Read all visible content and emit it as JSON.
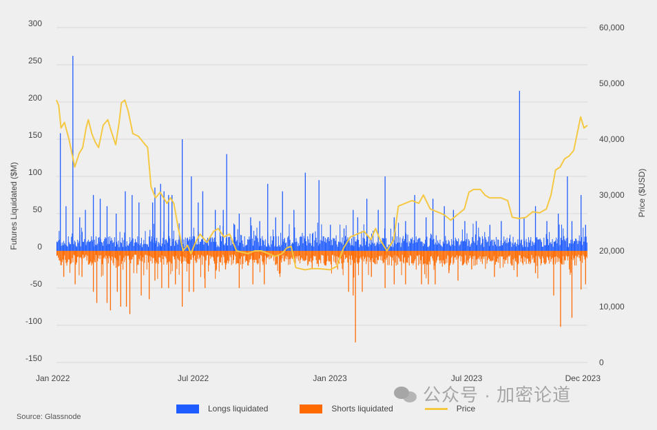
{
  "chart_data": {
    "type": "bar",
    "source": "Source: Glassnode",
    "ylabel_left": "Futures Liquidated ($M)",
    "ylabel_right": "Price ($USD)",
    "ylim_left": [
      -150,
      300
    ],
    "ylim_right": [
      0,
      60000
    ],
    "yticks_left": [
      "300",
      "250",
      "200",
      "150",
      "100",
      "50",
      "0",
      "-50",
      "-100",
      "-150"
    ],
    "yticks_left_values": [
      300,
      250,
      200,
      150,
      100,
      50,
      0,
      -50,
      -100,
      -150
    ],
    "yticks_right": [
      "60,000",
      "50,000",
      "40,000",
      "30,000",
      "20,000",
      "10,000",
      "0"
    ],
    "yticks_right_values": [
      60000,
      50000,
      40000,
      30000,
      20000,
      10000,
      0
    ],
    "xticks": [
      "Jan 2022",
      "Jul 2022",
      "Jan 2023",
      "Jul 2023",
      "Dec 2023"
    ],
    "xticks_months": [
      0,
      6,
      12,
      18,
      23
    ],
    "xlim_months": [
      0,
      23.3
    ],
    "grid": true,
    "colors": {
      "longs": "#1f5cff",
      "shorts": "#ff6a00",
      "price": "#f5c842",
      "grid": "#d9d9d9"
    },
    "series": [
      {
        "name": "Longs liquidated",
        "kind": "bar",
        "baseline_range": [
          5,
          20
        ],
        "spikes_month_value": [
          [
            0.15,
            158
          ],
          [
            0.4,
            60
          ],
          [
            0.7,
            262
          ],
          [
            1.0,
            45
          ],
          [
            1.25,
            55
          ],
          [
            1.6,
            75
          ],
          [
            1.9,
            70
          ],
          [
            2.2,
            60
          ],
          [
            2.6,
            50
          ],
          [
            3.0,
            80
          ],
          [
            3.3,
            75
          ],
          [
            3.6,
            65
          ],
          [
            4.2,
            65
          ],
          [
            4.3,
            85
          ],
          [
            4.55,
            90
          ],
          [
            4.7,
            80
          ],
          [
            4.9,
            75
          ],
          [
            5.05,
            75
          ],
          [
            5.5,
            150
          ],
          [
            5.9,
            100
          ],
          [
            6.2,
            65
          ],
          [
            6.4,
            80
          ],
          [
            6.95,
            55
          ],
          [
            7.3,
            55
          ],
          [
            7.45,
            130
          ],
          [
            7.8,
            35
          ],
          [
            8.0,
            50
          ],
          [
            8.5,
            45
          ],
          [
            8.9,
            40
          ],
          [
            9.25,
            90
          ],
          [
            9.6,
            45
          ],
          [
            9.9,
            80
          ],
          [
            10.4,
            55
          ],
          [
            10.9,
            105
          ],
          [
            11.5,
            95
          ],
          [
            12.0,
            35
          ],
          [
            12.6,
            30
          ],
          [
            13.0,
            55
          ],
          [
            13.2,
            45
          ],
          [
            13.6,
            70
          ],
          [
            14.1,
            55
          ],
          [
            14.4,
            100
          ],
          [
            14.8,
            45
          ],
          [
            15.3,
            40
          ],
          [
            15.7,
            75
          ],
          [
            16.2,
            45
          ],
          [
            16.5,
            70
          ],
          [
            17.0,
            60
          ],
          [
            17.4,
            55
          ],
          [
            17.9,
            40
          ],
          [
            18.4,
            40
          ],
          [
            19.0,
            35
          ],
          [
            19.5,
            40
          ],
          [
            20.3,
            215
          ],
          [
            20.5,
            45
          ],
          [
            21.0,
            60
          ],
          [
            21.5,
            40
          ],
          [
            22.0,
            50
          ],
          [
            22.4,
            100
          ],
          [
            22.6,
            40
          ],
          [
            23.0,
            75
          ],
          [
            23.2,
            35
          ]
        ]
      },
      {
        "name": "Shorts liquidated",
        "kind": "bar",
        "baseline_range": [
          -5,
          -20
        ],
        "spikes_month_value": [
          [
            0.3,
            -35
          ],
          [
            0.8,
            -45
          ],
          [
            1.1,
            -35
          ],
          [
            1.6,
            -55
          ],
          [
            1.75,
            -70
          ],
          [
            2.2,
            -70
          ],
          [
            2.35,
            -80
          ],
          [
            2.65,
            -55
          ],
          [
            2.8,
            -75
          ],
          [
            3.05,
            -75
          ],
          [
            3.2,
            -85
          ],
          [
            3.7,
            -60
          ],
          [
            4.05,
            -65
          ],
          [
            4.3,
            -40
          ],
          [
            4.6,
            -50
          ],
          [
            4.9,
            -50
          ],
          [
            5.2,
            -45
          ],
          [
            5.5,
            -75
          ],
          [
            5.8,
            -55
          ],
          [
            6.0,
            -55
          ],
          [
            6.5,
            -50
          ],
          [
            7.0,
            -25
          ],
          [
            7.4,
            -25
          ],
          [
            8.0,
            -50
          ],
          [
            8.6,
            -45
          ],
          [
            9.1,
            -45
          ],
          [
            9.8,
            -30
          ],
          [
            11.2,
            -25
          ],
          [
            11.8,
            -20
          ],
          [
            12.8,
            -55
          ],
          [
            13.0,
            -60
          ],
          [
            13.1,
            -123
          ],
          [
            13.4,
            -55
          ],
          [
            13.8,
            -35
          ],
          [
            14.4,
            -50
          ],
          [
            14.8,
            -45
          ],
          [
            15.3,
            -45
          ],
          [
            16.0,
            -45
          ],
          [
            16.3,
            -45
          ],
          [
            16.6,
            -45
          ],
          [
            17.2,
            -30
          ],
          [
            17.6,
            -40
          ],
          [
            18.2,
            -25
          ],
          [
            19.2,
            -35
          ],
          [
            20.2,
            -35
          ],
          [
            21.0,
            -30
          ],
          [
            21.8,
            -60
          ],
          [
            22.1,
            -102
          ],
          [
            22.6,
            -90
          ],
          [
            23.0,
            -52
          ],
          [
            23.2,
            -45
          ]
        ]
      },
      {
        "name": "Price",
        "kind": "line",
        "x_month": [
          0.0,
          0.1,
          0.2,
          0.35,
          0.55,
          0.7,
          0.8,
          1.0,
          1.15,
          1.3,
          1.4,
          1.55,
          1.7,
          1.85,
          2.05,
          2.25,
          2.4,
          2.6,
          2.75,
          2.85,
          3.0,
          3.15,
          3.35,
          3.6,
          3.8,
          4.0,
          4.15,
          4.35,
          4.55,
          4.7,
          4.85,
          5.0,
          5.15,
          5.35,
          5.55,
          5.75,
          5.9,
          6.1,
          6.3,
          6.6,
          6.9,
          7.1,
          7.35,
          7.6,
          7.9,
          8.1,
          8.4,
          8.7,
          9.0,
          9.3,
          9.6,
          9.9,
          10.1,
          10.3,
          10.5,
          10.9,
          11.2,
          11.5,
          11.8,
          12.0,
          12.3,
          12.6,
          12.9,
          13.2,
          13.5,
          13.8,
          14.0,
          14.2,
          14.5,
          14.8,
          15.0,
          15.3,
          15.6,
          15.9,
          16.1,
          16.4,
          16.7,
          17.0,
          17.3,
          17.6,
          17.9,
          18.1,
          18.3,
          18.6,
          18.8,
          19.0,
          19.2,
          19.5,
          19.8,
          20.0,
          20.3,
          20.6,
          20.9,
          21.2,
          21.5,
          21.7,
          21.9,
          22.1,
          22.3,
          22.5,
          22.7,
          22.85,
          23.0,
          23.15,
          23.3
        ],
        "y": [
          47000,
          46000,
          42000,
          43000,
          40000,
          37000,
          35000,
          37500,
          38500,
          42000,
          43500,
          41000,
          39500,
          38500,
          42500,
          43500,
          41500,
          39000,
          43000,
          46500,
          47000,
          45000,
          41000,
          40500,
          39500,
          38500,
          31500,
          29500,
          30500,
          29500,
          28500,
          29500,
          28500,
          24000,
          20000,
          21000,
          19500,
          21500,
          23000,
          21500,
          23500,
          24000,
          22500,
          23000,
          20000,
          19800,
          19500,
          20000,
          20000,
          19500,
          19000,
          19500,
          20500,
          20800,
          17000,
          16600,
          16800,
          16800,
          16700,
          16600,
          17200,
          20500,
          22500,
          23000,
          23500,
          22000,
          24000,
          22000,
          20000,
          22000,
          28000,
          28500,
          29000,
          28500,
          30000,
          27500,
          27000,
          26500,
          25500,
          26500,
          27500,
          30500,
          31000,
          31000,
          30000,
          29500,
          29500,
          29500,
          29000,
          26000,
          25800,
          26000,
          27000,
          26800,
          27500,
          30000,
          34500,
          35000,
          36500,
          37000,
          38000,
          41000,
          44000,
          42000,
          42500
        ]
      }
    ]
  },
  "legend": [
    {
      "label": "Longs liquidated",
      "color": "#1f5cff",
      "style": "box"
    },
    {
      "label": "Shorts liquidated",
      "color": "#ff6a00",
      "style": "box"
    },
    {
      "label": "Price",
      "color": "#f5c842",
      "style": "line"
    }
  ],
  "watermark": "公众号 · 加密论道"
}
